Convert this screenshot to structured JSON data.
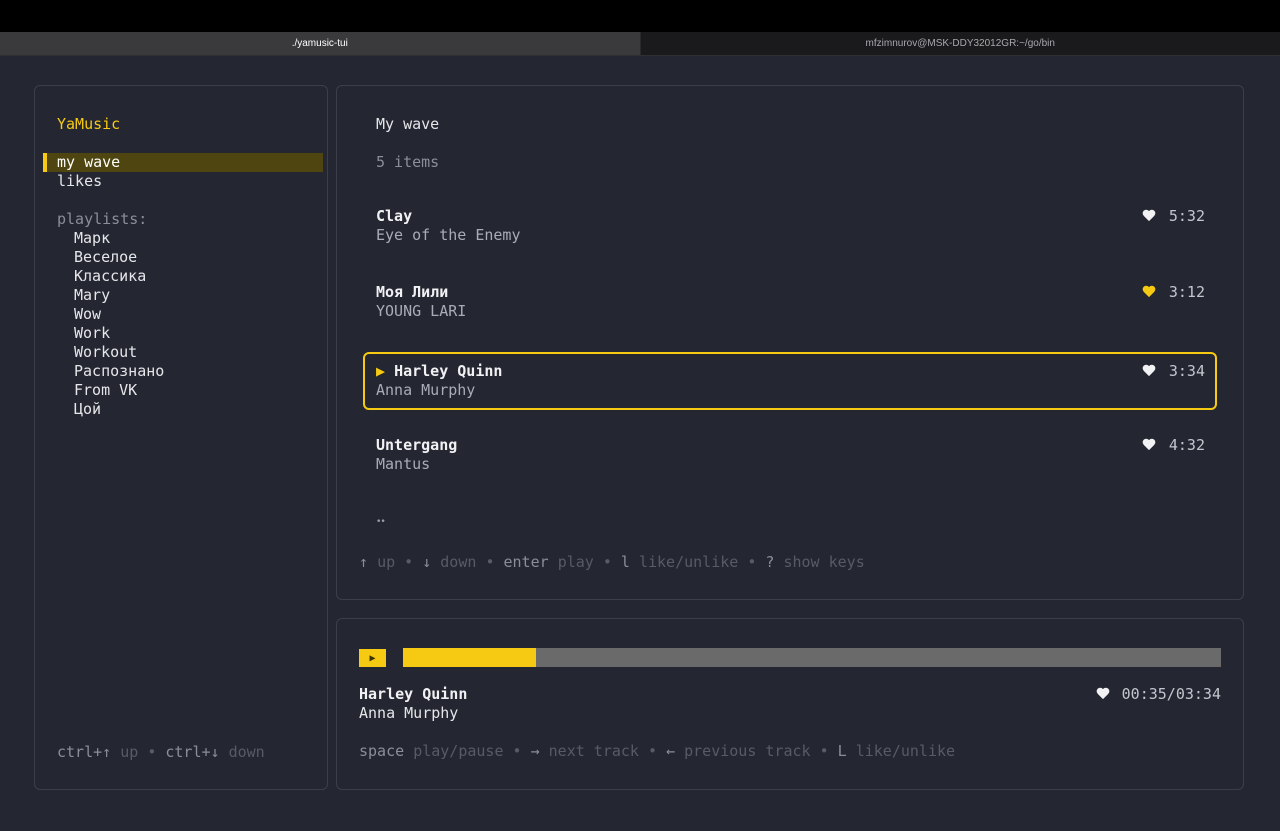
{
  "tabs": [
    {
      "label": "./yamusic-tui"
    },
    {
      "label": "mfzimnurov@MSK-DDY32012GR:~/go/bin"
    }
  ],
  "sidebar": {
    "app_title": "YaMusic",
    "nav": [
      {
        "label": "my wave",
        "selected": true
      },
      {
        "label": "likes",
        "selected": false
      }
    ],
    "playlists_heading": "playlists:",
    "playlists": [
      "Марк",
      "Веселое",
      "Классика",
      "Mary",
      "Wow",
      "Work",
      "Workout",
      "Распознано",
      "From VK",
      "Цой"
    ],
    "help": {
      "k1": "ctrl+↑",
      "a1": "up",
      "k2": "ctrl+↓",
      "a2": "down",
      "sep": "•"
    }
  },
  "tracklist": {
    "title": "My wave",
    "count": "5 items",
    "tracks": [
      {
        "title": "Clay",
        "artist": "Eye of the Enemy",
        "duration": "5:32",
        "liked": false,
        "playing": false
      },
      {
        "title": "Моя Лили",
        "artist": "YOUNG LARI",
        "duration": "3:12",
        "liked": true,
        "playing": false
      },
      {
        "title": "Harley Quinn",
        "artist": "Anna Murphy",
        "duration": "3:34",
        "liked": false,
        "playing": true
      },
      {
        "title": "Untergang",
        "artist": "Mantus",
        "duration": "4:32",
        "liked": false,
        "playing": false
      }
    ],
    "playing_marker": "▶",
    "pager": "••",
    "help": [
      {
        "key": "↑",
        "action": "up"
      },
      {
        "key": "↓",
        "action": "down"
      },
      {
        "key": "enter",
        "action": "play"
      },
      {
        "key": "l",
        "action": "like/unlike"
      },
      {
        "key": "?",
        "action": "show keys"
      }
    ]
  },
  "player": {
    "play_icon": "▶",
    "progress_fraction": 0.163,
    "track_title": "Harley Quinn",
    "track_artist": "Anna Murphy",
    "time": "00:35/03:34",
    "liked": false,
    "help": [
      {
        "key": "space",
        "action": "play/pause"
      },
      {
        "key": "→",
        "action": "next track"
      },
      {
        "key": "←",
        "action": "previous track"
      },
      {
        "key": "L",
        "action": "like/unlike"
      }
    ]
  },
  "colors": {
    "accent": "#f6c913",
    "background": "#242731",
    "liked_heart": "#f6c913",
    "unliked_heart": "#f2f2f4"
  }
}
